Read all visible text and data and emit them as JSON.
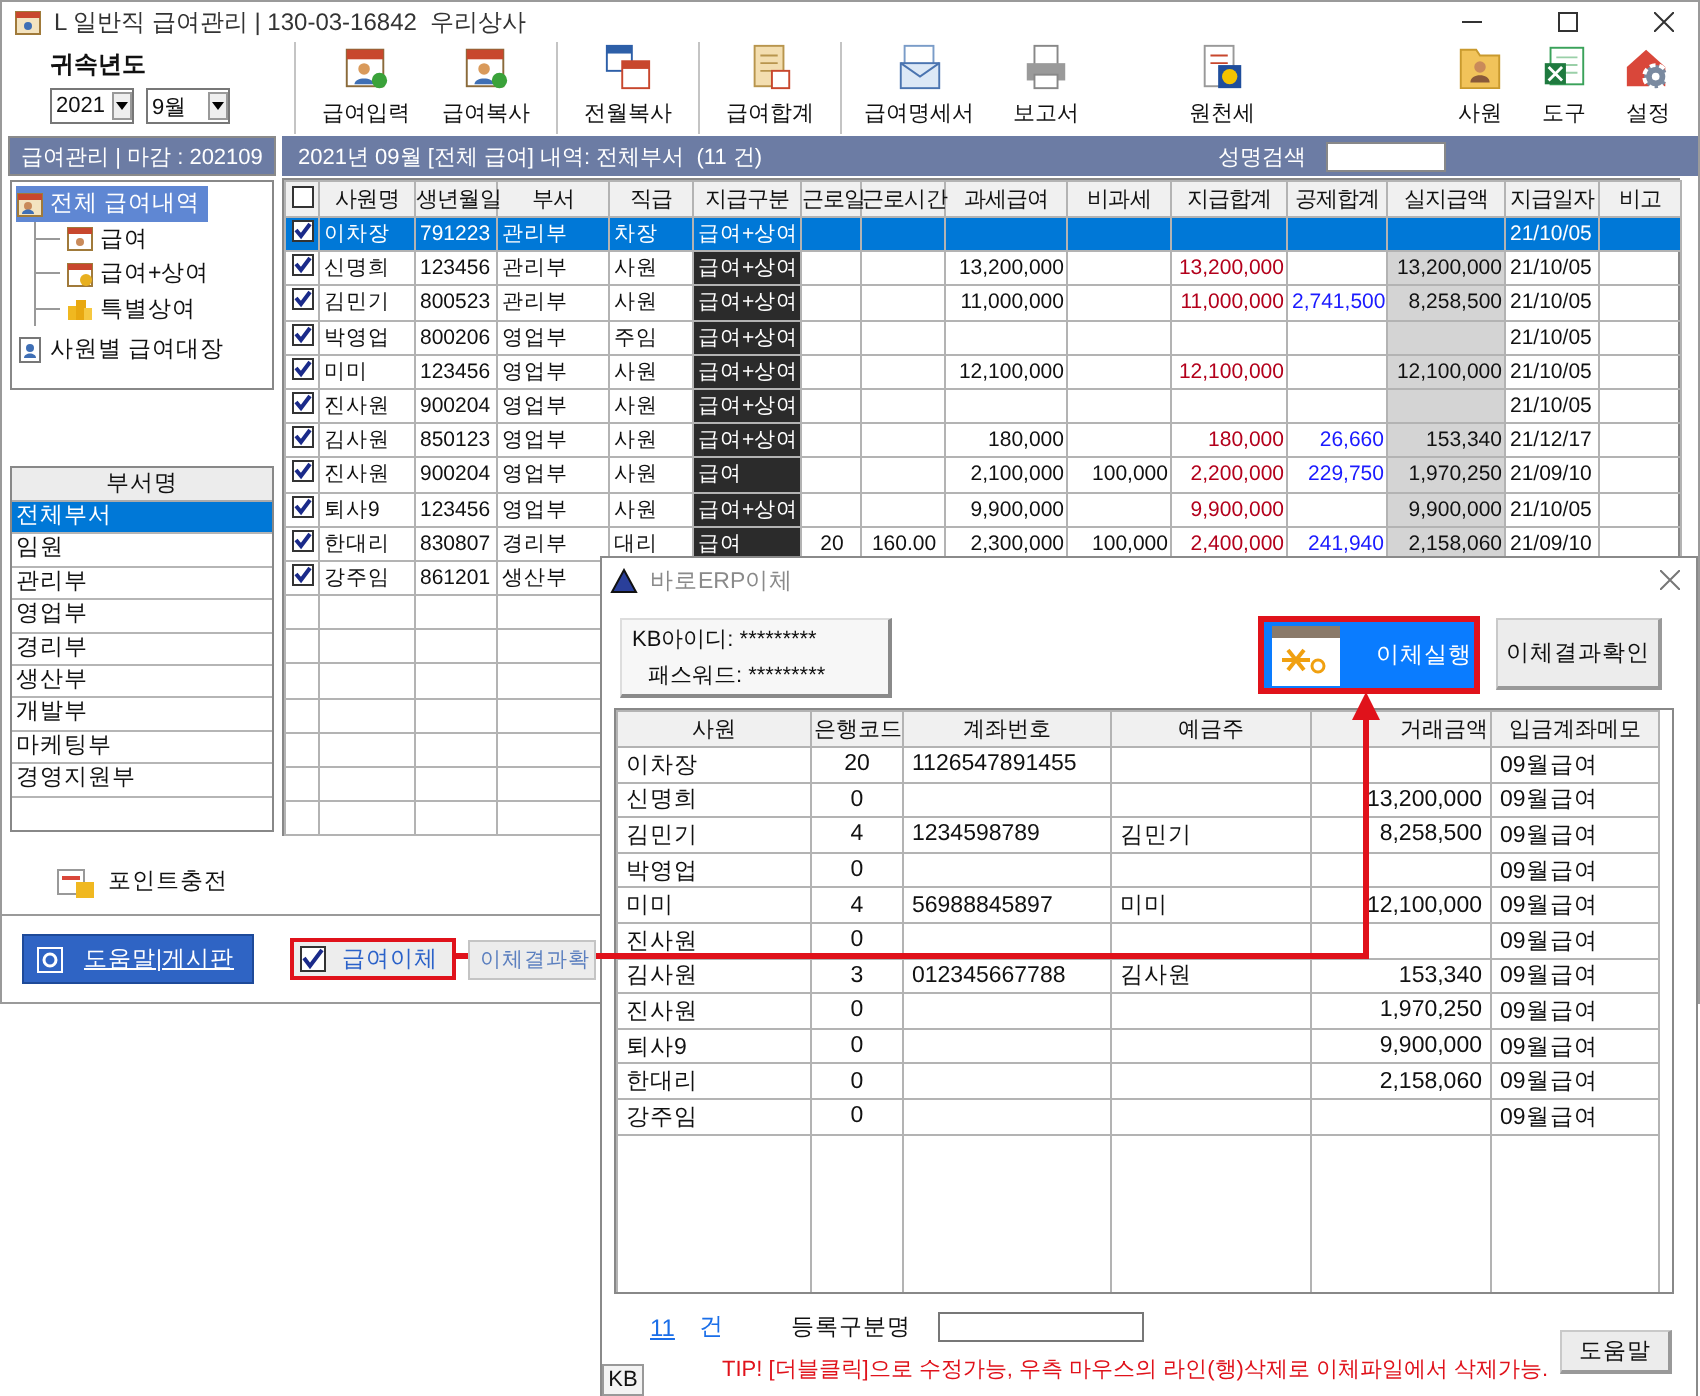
{
  "window": {
    "title": "L 일반직 급여관리 | 130-03-16842  우리상사"
  },
  "period": {
    "label": "귀속년도",
    "year": "2021",
    "month": "9월"
  },
  "toolbar": {
    "groups": [
      {
        "divided": true,
        "items": [
          {
            "label": "급여입력",
            "kind": "calendar"
          },
          {
            "label": "급여복사",
            "kind": "calendar"
          }
        ]
      },
      {
        "divided": true,
        "items": [
          {
            "label": "전월복사",
            "kind": "calendars"
          }
        ]
      },
      {
        "divided": true,
        "items": [
          {
            "label": "급여합계",
            "kind": "sum"
          }
        ]
      },
      {
        "divided": true,
        "items": [
          {
            "label": "급여명세서",
            "kind": "mail"
          },
          {
            "label": "보고서",
            "kind": "printer"
          }
        ]
      },
      {
        "divided": false,
        "items": [
          {
            "label": "원천세",
            "kind": "tax"
          }
        ]
      }
    ],
    "right": [
      {
        "label": "사원",
        "kind": "person"
      },
      {
        "label": "도구",
        "kind": "sheet"
      },
      {
        "label": "설정",
        "kind": "gear"
      }
    ]
  },
  "closing_header": "급여관리 | 마감 : 202109",
  "tree": [
    {
      "label": "전체 급여내역",
      "kind": "card",
      "selected": true,
      "children": [
        {
          "label": "급여",
          "kind": "calendar",
          "selected": false
        },
        {
          "label": "급여+상여",
          "kind": "bonus",
          "selected": false
        },
        {
          "label": "특별상여",
          "kind": "coins",
          "selected": false
        }
      ]
    },
    {
      "label": "사원별 급여대장",
      "kind": "document",
      "selected": false
    }
  ],
  "departments": {
    "header": "부서명",
    "items": [
      {
        "label": "전체부서",
        "selected": true
      },
      {
        "label": "임원",
        "selected": false
      },
      {
        "label": "관리부",
        "selected": false
      },
      {
        "label": "영업부",
        "selected": false
      },
      {
        "label": "경리부",
        "selected": false
      },
      {
        "label": "생산부",
        "selected": false
      },
      {
        "label": "개발부",
        "selected": false
      },
      {
        "label": "마케팅부",
        "selected": false
      },
      {
        "label": "경영지원부",
        "selected": false
      }
    ]
  },
  "point_button": "포인트충전",
  "list_header": {
    "title": "2021년 09월 [전체 급여] 내역: 전체부서  (11 건)",
    "search_label": "성명검색"
  },
  "table": {
    "all_checked": false,
    "columns": [
      "사원명",
      "생년월일",
      "부서",
      "직급",
      "지급구분",
      "근로일",
      "근로시간",
      "과세급여",
      "비과세",
      "지급합계",
      "공제합계",
      "실지급액",
      "지급일자",
      "비고"
    ],
    "rows": [
      {
        "checked": true,
        "selected": true,
        "name": "이차장",
        "birth": "791223",
        "dept": "관리부",
        "rank": "차장",
        "pay_type": "급여+상여",
        "pay_date": "21/10/05"
      },
      {
        "checked": true,
        "selected": false,
        "name": "신명희",
        "birth": "123456",
        "dept": "관리부",
        "rank": "사원",
        "pay_type": "급여+상여",
        "taxable": "13,200,000",
        "total_pay": "13,200,000",
        "net_pay": "13,200,000",
        "pay_date": "21/10/05"
      },
      {
        "checked": true,
        "selected": false,
        "name": "김민기",
        "birth": "800523",
        "dept": "관리부",
        "rank": "사원",
        "pay_type": "급여+상여",
        "taxable": "11,000,000",
        "total_pay": "11,000,000",
        "deductions": "2,741,500",
        "net_pay": "8,258,500",
        "pay_date": "21/10/05"
      },
      {
        "checked": true,
        "selected": false,
        "name": "박영업",
        "birth": "800206",
        "dept": "영업부",
        "rank": "주임",
        "pay_type": "급여+상여",
        "pay_date": "21/10/05"
      },
      {
        "checked": true,
        "selected": false,
        "name": "미미",
        "birth": "123456",
        "dept": "영업부",
        "rank": "사원",
        "pay_type": "급여+상여",
        "taxable": "12,100,000",
        "total_pay": "12,100,000",
        "net_pay": "12,100,000",
        "pay_date": "21/10/05"
      },
      {
        "checked": true,
        "selected": false,
        "name": "진사원",
        "birth": "900204",
        "dept": "영업부",
        "rank": "사원",
        "pay_type": "급여+상여",
        "pay_date": "21/10/05"
      },
      {
        "checked": true,
        "selected": false,
        "name": "김사원",
        "birth": "850123",
        "dept": "영업부",
        "rank": "사원",
        "pay_type": "급여+상여",
        "taxable": "180,000",
        "total_pay": "180,000",
        "deductions": "26,660",
        "net_pay": "153,340",
        "pay_date": "21/12/17"
      },
      {
        "checked": true,
        "selected": false,
        "name": "진사원",
        "birth": "900204",
        "dept": "영업부",
        "rank": "사원",
        "pay_type": "급여",
        "taxable": "2,100,000",
        "nontaxable": "100,000",
        "total_pay": "2,200,000",
        "deductions": "229,750",
        "net_pay": "1,970,250",
        "pay_date": "21/09/10"
      },
      {
        "checked": true,
        "selected": false,
        "name": "퇴사9",
        "birth": "123456",
        "dept": "영업부",
        "rank": "사원",
        "pay_type": "급여+상여",
        "taxable": "9,900,000",
        "total_pay": "9,900,000",
        "net_pay": "9,900,000",
        "pay_date": "21/10/05"
      },
      {
        "checked": true,
        "selected": false,
        "name": "한대리",
        "birth": "830807",
        "dept": "경리부",
        "rank": "대리",
        "pay_type": "급여",
        "work_days": "20",
        "work_hours": "160.00",
        "taxable": "2,300,000",
        "nontaxable": "100,000",
        "total_pay": "2,400,000",
        "deductions": "241,940",
        "net_pay": "2,158,060",
        "pay_date": "21/09/10"
      },
      {
        "checked": true,
        "selected": false,
        "name": "강주임",
        "birth": "861201",
        "dept": "생산부"
      }
    ]
  },
  "bottom": {
    "help_button": "도움말|게시판",
    "transfer_checkbox": {
      "label": "급여이체",
      "checked": true
    },
    "result_button": "이체결과확"
  },
  "transfer_dialog": {
    "title": "바로ERP이체",
    "credentials": [
      {
        "label": "KB아이디:",
        "value": "*********"
      },
      {
        "label": "패스워드:",
        "value": "*********"
      }
    ],
    "execute_button": "이체실행",
    "result_button": "이체결과확인",
    "columns": [
      "사원",
      "은행코드",
      "계좌번호",
      "예금주",
      "거래금액",
      "입금계좌메모"
    ],
    "rows": [
      {
        "employee": "이차장",
        "bank_code": "20",
        "account": "1126547891455",
        "memo": "09월급여"
      },
      {
        "employee": "신명희",
        "bank_code": "0",
        "amount": "13,200,000",
        "memo": "09월급여"
      },
      {
        "employee": "김민기",
        "bank_code": "4",
        "account": "1234598789",
        "holder": "김민기",
        "amount": "8,258,500",
        "memo": "09월급여"
      },
      {
        "employee": "박영업",
        "bank_code": "0",
        "memo": "09월급여"
      },
      {
        "employee": "미미",
        "bank_code": "4",
        "account": "56988845897",
        "holder": "미미",
        "amount": "12,100,000",
        "memo": "09월급여"
      },
      {
        "employee": "진사원",
        "bank_code": "0",
        "memo": "09월급여"
      },
      {
        "employee": "김사원",
        "bank_code": "3",
        "account": "012345667788",
        "holder": "김사원",
        "amount": "153,340",
        "memo": "09월급여"
      },
      {
        "employee": "진사원",
        "bank_code": "0",
        "amount": "1,970,250",
        "memo": "09월급여"
      },
      {
        "employee": "퇴사9",
        "bank_code": "0",
        "amount": "9,900,000",
        "memo": "09월급여"
      },
      {
        "employee": "한대리",
        "bank_code": "0",
        "amount": "2,158,060",
        "memo": "09월급여"
      },
      {
        "employee": "강주임",
        "bank_code": "0",
        "memo": "09월급여"
      }
    ],
    "count": "11",
    "count_unit": "건",
    "registration_label": "등록구분명",
    "tip": "TIP! [더블클릭]으로 수정가능, 우측 마우스의 라인(행)삭제로 이체파일에서 삭제가능.",
    "help_button": "도움말",
    "status": "KB"
  }
}
